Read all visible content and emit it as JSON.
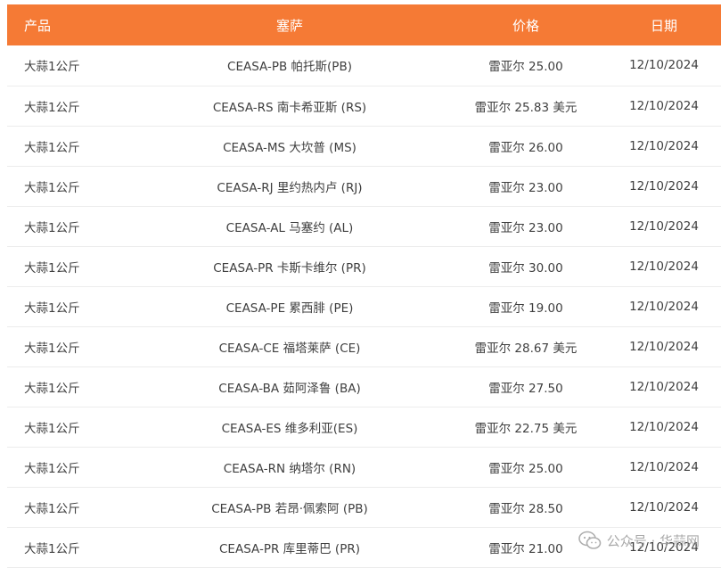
{
  "headers": {
    "product": "产品",
    "ceasa": "塞萨",
    "price": "价格",
    "date": "日期"
  },
  "rows": [
    {
      "product": "大蒜1公斤",
      "ceasa": "CEASA-PB 帕托斯(PB)",
      "price": "雷亚尔 25.00",
      "date": "12/10/2024"
    },
    {
      "product": "大蒜1公斤",
      "ceasa": "CEASA-RS 南卡希亚斯 (RS)",
      "price": "雷亚尔 25.83 美元",
      "date": "12/10/2024"
    },
    {
      "product": "大蒜1公斤",
      "ceasa": "CEASA-MS 大坎普 (MS)",
      "price": "雷亚尔 26.00",
      "date": "12/10/2024"
    },
    {
      "product": "大蒜1公斤",
      "ceasa": "CEASA-RJ 里约热内卢 (RJ)",
      "price": "雷亚尔 23.00",
      "date": "12/10/2024"
    },
    {
      "product": "大蒜1公斤",
      "ceasa": "CEASA-AL 马塞约 (AL)",
      "price": "雷亚尔 23.00",
      "date": "12/10/2024"
    },
    {
      "product": "大蒜1公斤",
      "ceasa": "CEASA-PR 卡斯卡维尔 (PR)",
      "price": "雷亚尔 30.00",
      "date": "12/10/2024"
    },
    {
      "product": "大蒜1公斤",
      "ceasa": "CEASA-PE 累西腓 (PE)",
      "price": "雷亚尔 19.00",
      "date": "12/10/2024"
    },
    {
      "product": "大蒜1公斤",
      "ceasa": "CEASA-CE 福塔莱萨 (CE)",
      "price": "雷亚尔 28.67 美元",
      "date": "12/10/2024"
    },
    {
      "product": "大蒜1公斤",
      "ceasa": "CEASA-BA 茹阿泽鲁 (BA)",
      "price": "雷亚尔 27.50",
      "date": "12/10/2024"
    },
    {
      "product": "大蒜1公斤",
      "ceasa": "CEASA-ES 维多利亚(ES)",
      "price": "雷亚尔 22.75 美元",
      "date": "12/10/2024"
    },
    {
      "product": "大蒜1公斤",
      "ceasa": "CEASA-RN 纳塔尔 (RN)",
      "price": "雷亚尔 25.00",
      "date": "12/10/2024"
    },
    {
      "product": "大蒜1公斤",
      "ceasa": "CEASA-PB 若昂·佩索阿 (PB)",
      "price": "雷亚尔 28.50",
      "date": "12/10/2024"
    },
    {
      "product": "大蒜1公斤",
      "ceasa": "CEASA-PR 库里蒂巴 (PR)",
      "price": "雷亚尔 21.00",
      "date": "12/10/2024"
    }
  ],
  "watermark": {
    "text": "公众号 · 华蒜网",
    "icon": "wechat-icon"
  },
  "colors": {
    "header_bg": "#f57a35",
    "header_text": "#ffffff",
    "row_border": "#ececec"
  }
}
